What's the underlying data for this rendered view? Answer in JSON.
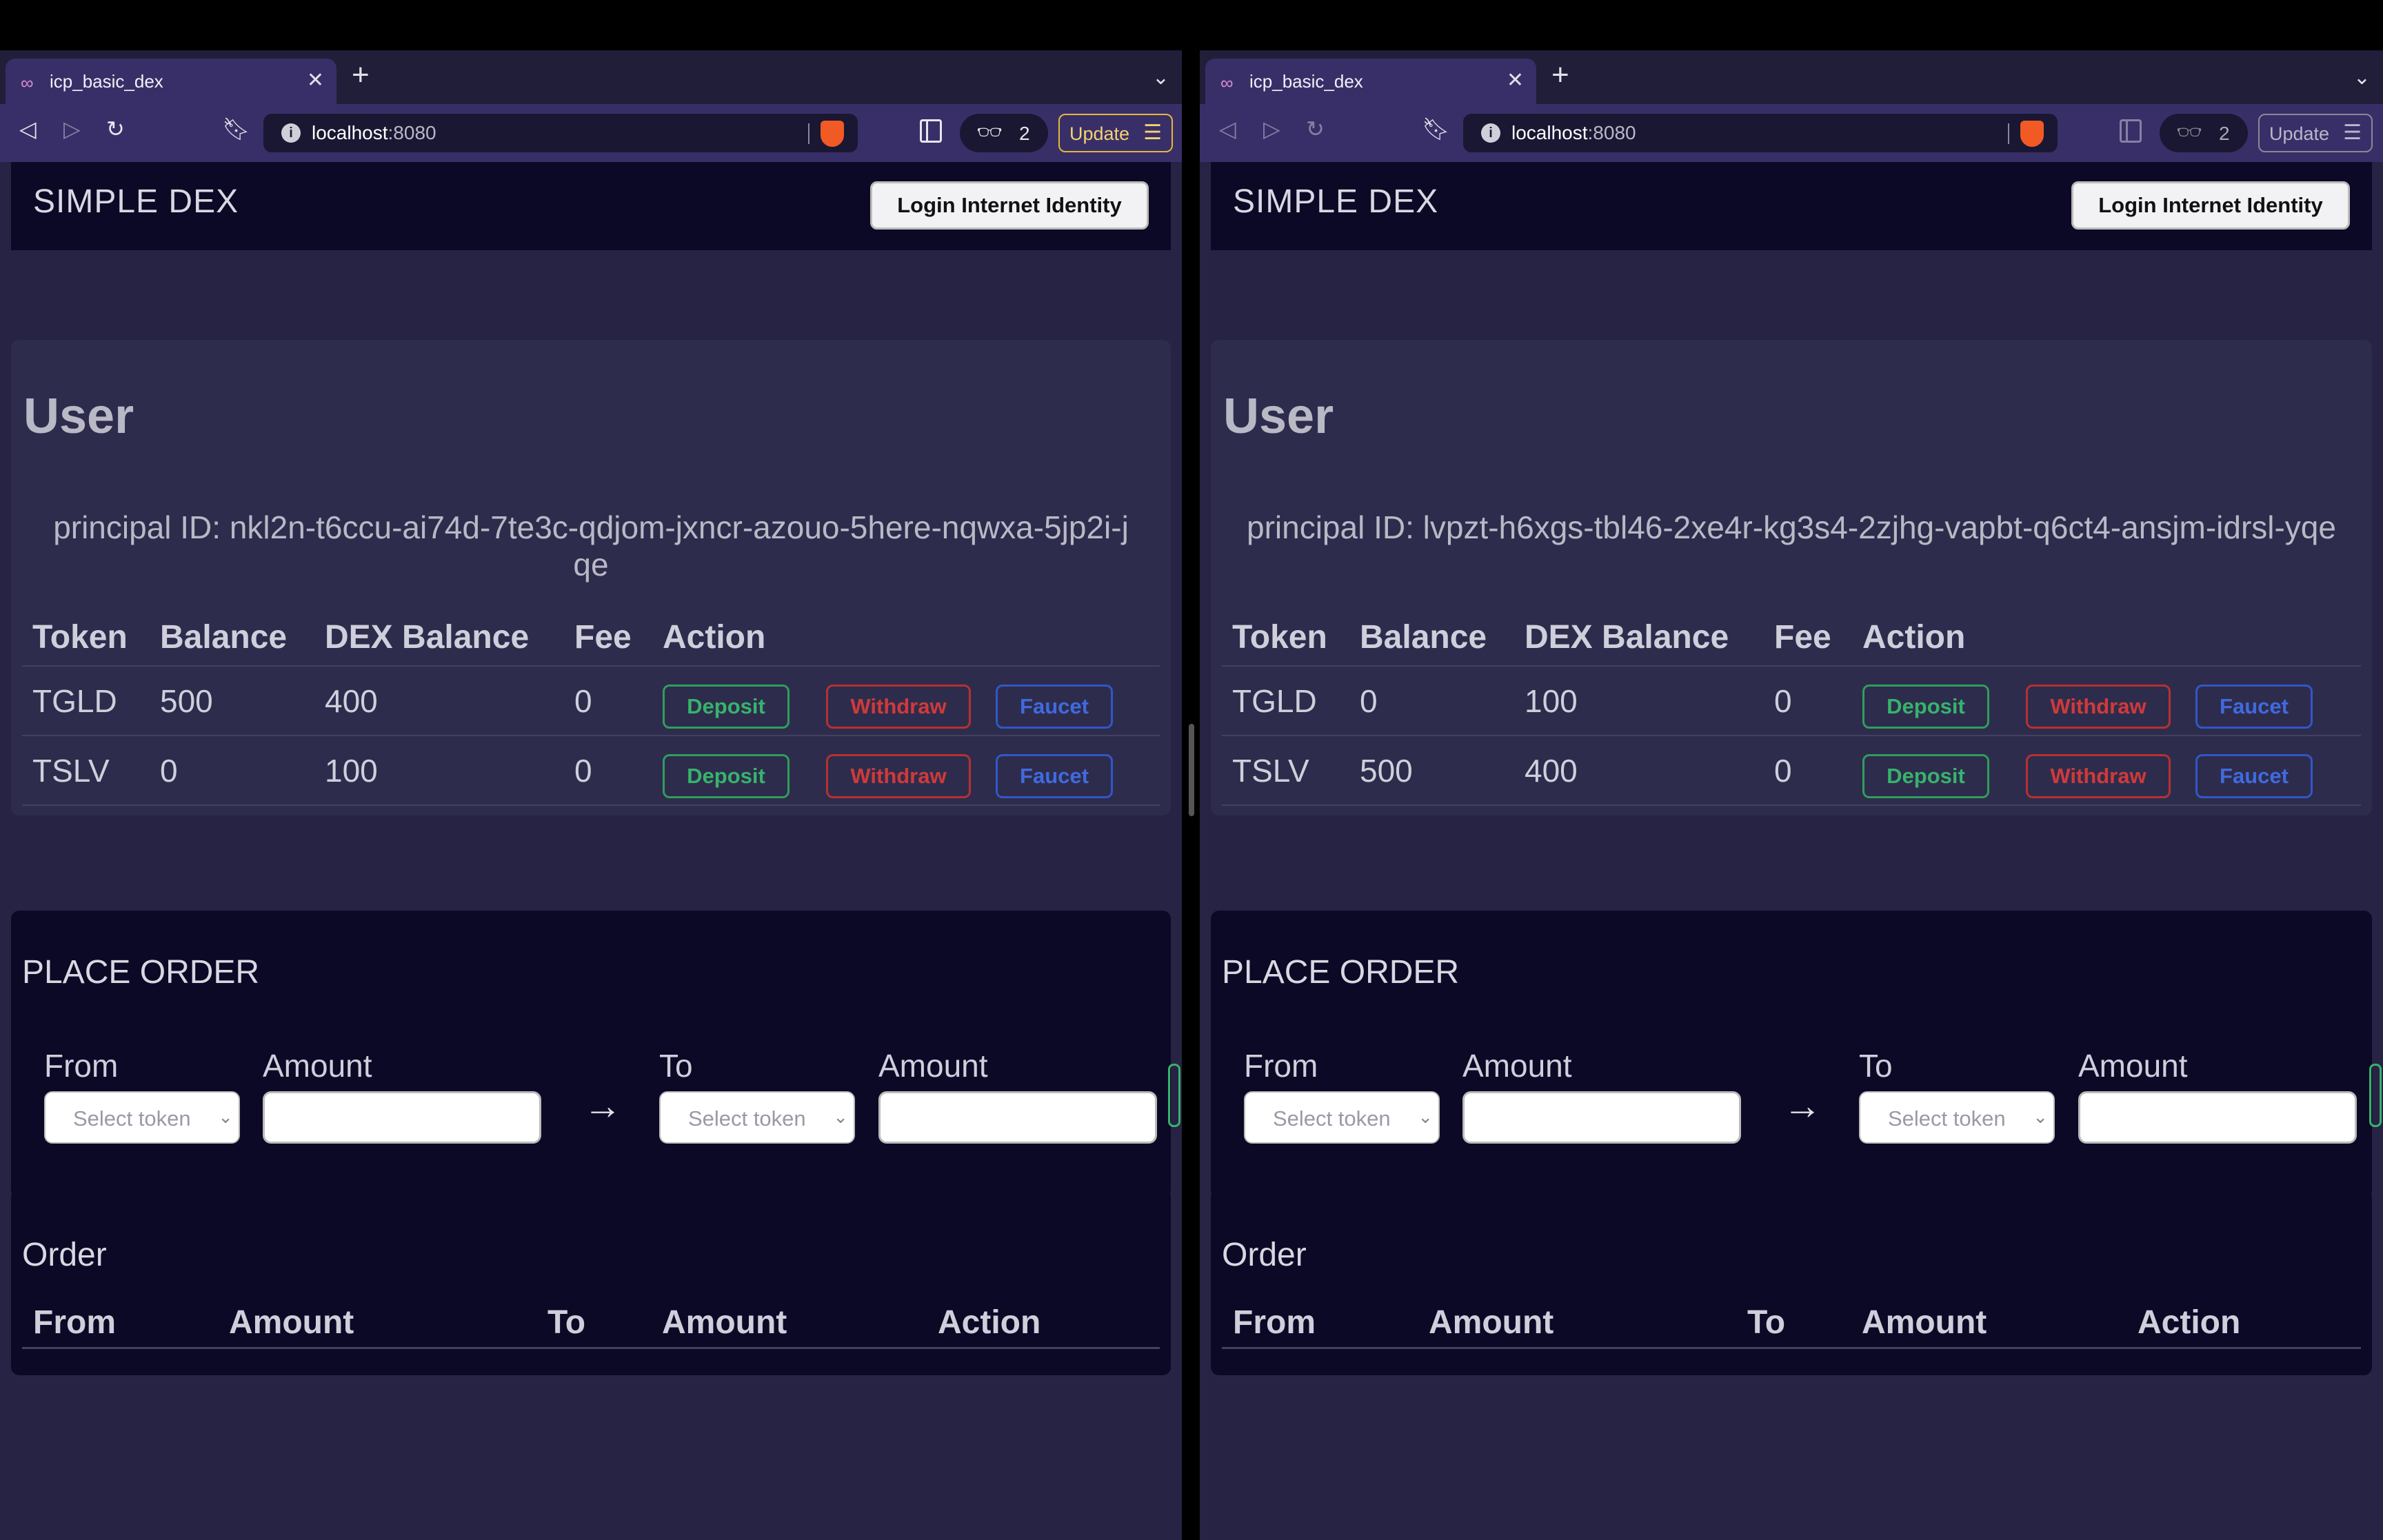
{
  "browser": {
    "tab_title": "icp_basic_dex",
    "url_host": "localhost",
    "url_port": ":8080",
    "vpn_count": "2",
    "update_label": "Update",
    "accent_color": "#382f68"
  },
  "app": {
    "brand": "SIMPLE DEX",
    "login_label": "Login Internet Identity",
    "user_heading": "User",
    "token_table_headers": {
      "token": "Token",
      "balance": "Balance",
      "dex_balance": "DEX Balance",
      "fee": "Fee",
      "action": "Action"
    },
    "action_labels": {
      "deposit": "Deposit",
      "withdraw": "Withdraw",
      "faucet": "Faucet"
    },
    "place_order": {
      "heading": "PLACE ORDER",
      "from_label": "From",
      "amount_label": "Amount",
      "to_label": "To",
      "to_amount_label": "Amount",
      "select_placeholder": "Select token",
      "arrow": "→"
    },
    "orders": {
      "heading": "Order",
      "headers": [
        "From",
        "Amount",
        "To",
        "Amount",
        "Action"
      ]
    }
  },
  "windows": [
    {
      "principal_text": "principal ID: nkl2n-t6ccu-ai74d-7te3c-qdjom-jxncr-azouo-5here-nqwxa-5jp2i-jqe",
      "tokens": [
        {
          "token": "TGLD",
          "balance": "500",
          "dex_balance": "400",
          "fee": "0"
        },
        {
          "token": "TSLV",
          "balance": "0",
          "dex_balance": "100",
          "fee": "0"
        }
      ]
    },
    {
      "principal_text": "principal ID: lvpzt-h6xgs-tbl46-2xe4r-kg3s4-2zjhg-vapbt-q6ct4-ansjm-idrsl-yqe",
      "tokens": [
        {
          "token": "TGLD",
          "balance": "0",
          "dex_balance": "100",
          "fee": "0"
        },
        {
          "token": "TSLV",
          "balance": "500",
          "dex_balance": "400",
          "fee": "0"
        }
      ]
    }
  ]
}
